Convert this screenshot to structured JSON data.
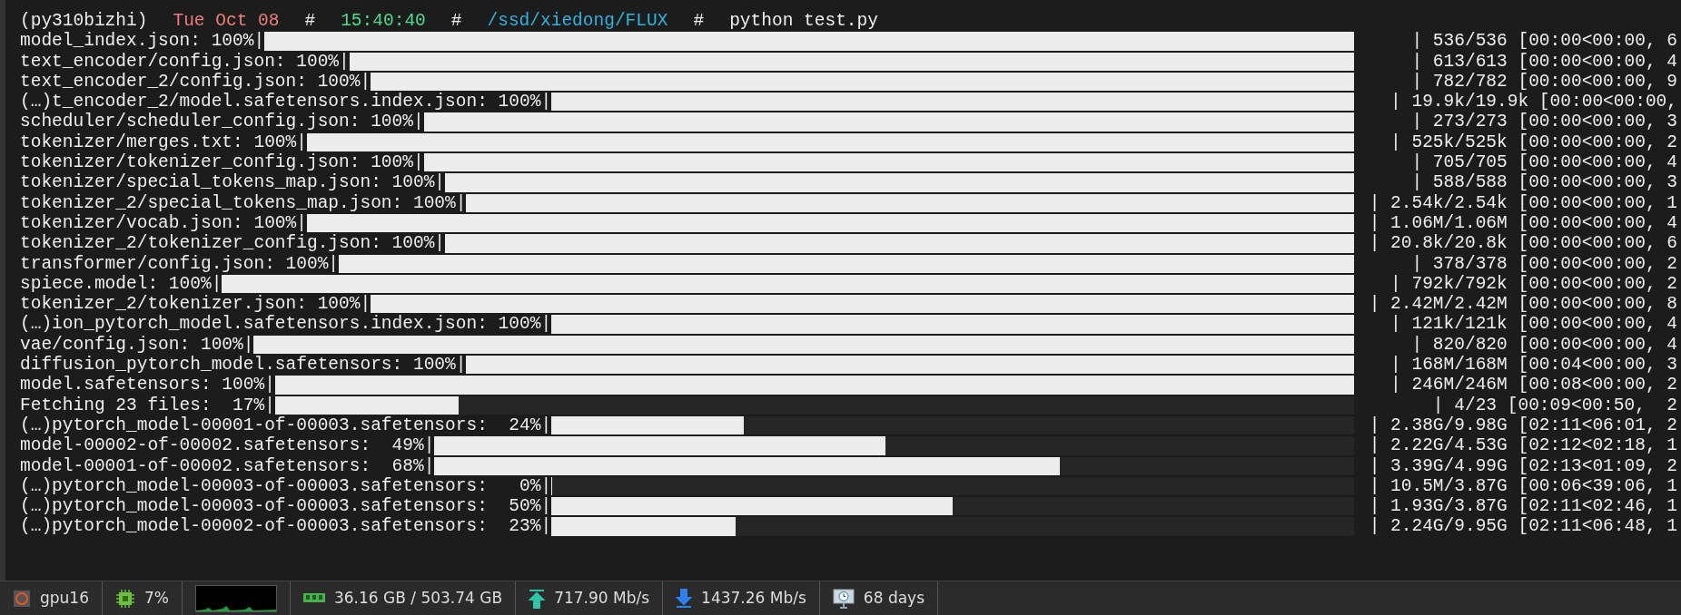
{
  "prompt": [
    {
      "kind": "env",
      "text": "(py310bizhi)"
    },
    {
      "kind": "date",
      "text": "Tue Oct 08"
    },
    {
      "kind": "separator",
      "text": "#"
    },
    {
      "kind": "time",
      "text": "15:40:40"
    },
    {
      "kind": "separator",
      "text": "#"
    },
    {
      "kind": "path",
      "text": "/ssd/xiedong/FLUX"
    },
    {
      "kind": "separator",
      "text": "#"
    },
    {
      "kind": "command",
      "text": "python test.py"
    }
  ],
  "progress": [
    {
      "label": "model_index.json: 100%|",
      "level": 1,
      "stats": "| 536/536 [00:00<00:00, 6"
    },
    {
      "label": "text_encoder/config.json: 100%|",
      "level": 1,
      "stats": "| 613/613 [00:00<00:00, 4"
    },
    {
      "label": "text_encoder_2/config.json: 100%|",
      "level": 1,
      "stats": "| 782/782 [00:00<00:00, 9"
    },
    {
      "label": "(…)t_encoder_2/model.safetensors.index.json: 100%|",
      "level": 1,
      "stats": "| 19.9k/19.9k [00:00<00:00,"
    },
    {
      "label": "scheduler/scheduler_config.json: 100%|",
      "level": 1,
      "stats": "| 273/273 [00:00<00:00, 3"
    },
    {
      "label": "tokenizer/merges.txt: 100%|",
      "level": 1,
      "stats": "| 525k/525k [00:00<00:00, 2"
    },
    {
      "label": "tokenizer/tokenizer_config.json: 100%|",
      "level": 1,
      "stats": "| 705/705 [00:00<00:00, 4"
    },
    {
      "label": "tokenizer/special_tokens_map.json: 100%|",
      "level": 1,
      "stats": "| 588/588 [00:00<00:00, 3"
    },
    {
      "label": "tokenizer_2/special_tokens_map.json: 100%|",
      "level": 1,
      "stats": "| 2.54k/2.54k [00:00<00:00, 1"
    },
    {
      "label": "tokenizer/vocab.json: 100%|",
      "level": 1,
      "stats": "| 1.06M/1.06M [00:00<00:00, 4"
    },
    {
      "label": "tokenizer_2/tokenizer_config.json: 100%|",
      "level": 1,
      "stats": "| 20.8k/20.8k [00:00<00:00, 6"
    },
    {
      "label": "transformer/config.json: 100%|",
      "level": 1,
      "stats": "| 378/378 [00:00<00:00, 2"
    },
    {
      "label": "spiece.model: 100%|",
      "level": 1,
      "stats": "| 792k/792k [00:00<00:00, 2"
    },
    {
      "label": "tokenizer_2/tokenizer.json: 100%|",
      "level": 1,
      "stats": "| 2.42M/2.42M [00:00<00:00, 8"
    },
    {
      "label": "(…)ion_pytorch_model.safetensors.index.json: 100%|",
      "level": 1,
      "stats": "| 121k/121k [00:00<00:00, 4"
    },
    {
      "label": "vae/config.json: 100%|",
      "level": 1,
      "stats": "| 820/820 [00:00<00:00, 4"
    },
    {
      "label": "diffusion_pytorch_model.safetensors: 100%|",
      "level": 1,
      "stats": "| 168M/168M [00:04<00:00, 3"
    },
    {
      "label": "model.safetensors: 100%|",
      "level": 1,
      "stats": "| 246M/246M [00:08<00:00, 2"
    },
    {
      "label": "Fetching 23 files:  17%|",
      "level": 0.17,
      "stats": "| 4/23 [00:09<00:50,  2"
    },
    {
      "label": "(…)pytorch_model-00001-of-00003.safetensors:  24%|",
      "level": 0.24,
      "stats": "| 2.38G/9.98G [02:11<06:01, 2"
    },
    {
      "label": "model-00002-of-00002.safetensors:  49%|",
      "level": 0.49,
      "stats": "| 2.22G/4.53G [02:12<02:18, 1"
    },
    {
      "label": "model-00001-of-00002.safetensors:  68%|",
      "level": 0.68,
      "stats": "| 3.39G/4.99G [02:13<01:09, 2"
    },
    {
      "label": "(…)pytorch_model-00003-of-00003.safetensors:   0%|",
      "level": 0,
      "stats": "| 10.5M/3.87G [00:06<39:06, 1"
    },
    {
      "label": "(…)pytorch_model-00003-of-00003.safetensors:  50%|",
      "level": 0.5,
      "stats": "| 1.93G/3.87G [02:11<02:46, 1"
    },
    {
      "label": "(…)pytorch_model-00002-of-00003.safetensors:  23%|",
      "level": 0.23,
      "stats": "| 2.24G/9.95G [02:11<06:48, 1"
    }
  ],
  "status_bar": [
    {
      "kind": "host",
      "text": "gpu16"
    },
    {
      "kind": "cpu",
      "text": "7%"
    },
    {
      "kind": "graph"
    },
    {
      "kind": "memory",
      "text": "36.16 GB / 503.74 GB"
    },
    {
      "kind": "upload",
      "text": "717.90 Mb/s"
    },
    {
      "kind": "download",
      "text": "1437.26 Mb/s"
    },
    {
      "kind": "uptime",
      "text": "68 days"
    }
  ]
}
